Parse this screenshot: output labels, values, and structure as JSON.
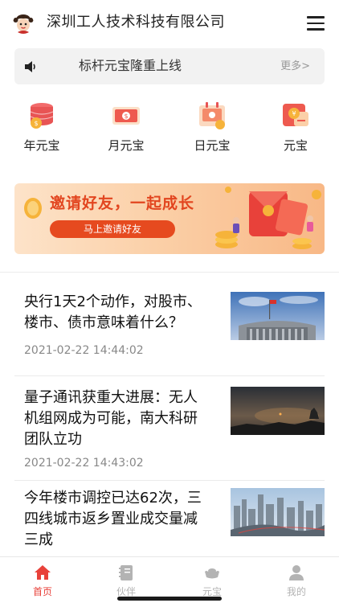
{
  "header": {
    "company_name": "深圳工人技术科技有限公司",
    "avatar_icon": "avatar-icon",
    "menu_icon": "hamburger-menu-icon"
  },
  "notice": {
    "icon": "speaker-icon",
    "text": "标杆元宝隆重上线",
    "more": "更多>"
  },
  "categories": [
    {
      "label": "年元宝",
      "icon": "coin-stack-icon"
    },
    {
      "label": "月元宝",
      "icon": "cash-icon"
    },
    {
      "label": "日元宝",
      "icon": "calendar-coin-icon"
    },
    {
      "label": "元宝",
      "icon": "wallet-coin-icon"
    }
  ],
  "banner": {
    "slogan": "邀请好友，一起成长",
    "cta": "马上邀请好友"
  },
  "news": [
    {
      "title": "央行1天2个动作，对股市、楼市、债市意味着什么？",
      "time": "2021-02-22 14:44:02"
    },
    {
      "title": "量子通讯获重大进展：无人机组网成为可能，南大科研团队立功",
      "time": "2021-02-22 14:43:02"
    },
    {
      "title": "今年楼市调控已达62次，三四线城市返乡置业成交量减三成",
      "time": ""
    }
  ],
  "tabbar": [
    {
      "label": "首页",
      "icon": "home-icon",
      "active": true
    },
    {
      "label": "伙伴",
      "icon": "notebook-icon",
      "active": false
    },
    {
      "label": "元宝",
      "icon": "ingot-icon",
      "active": false
    },
    {
      "label": "我的",
      "icon": "user-icon",
      "active": false
    }
  ],
  "colors": {
    "accent": "#e8413a",
    "banner_text": "#e2451f",
    "tab_inactive": "#b3b3b3"
  }
}
